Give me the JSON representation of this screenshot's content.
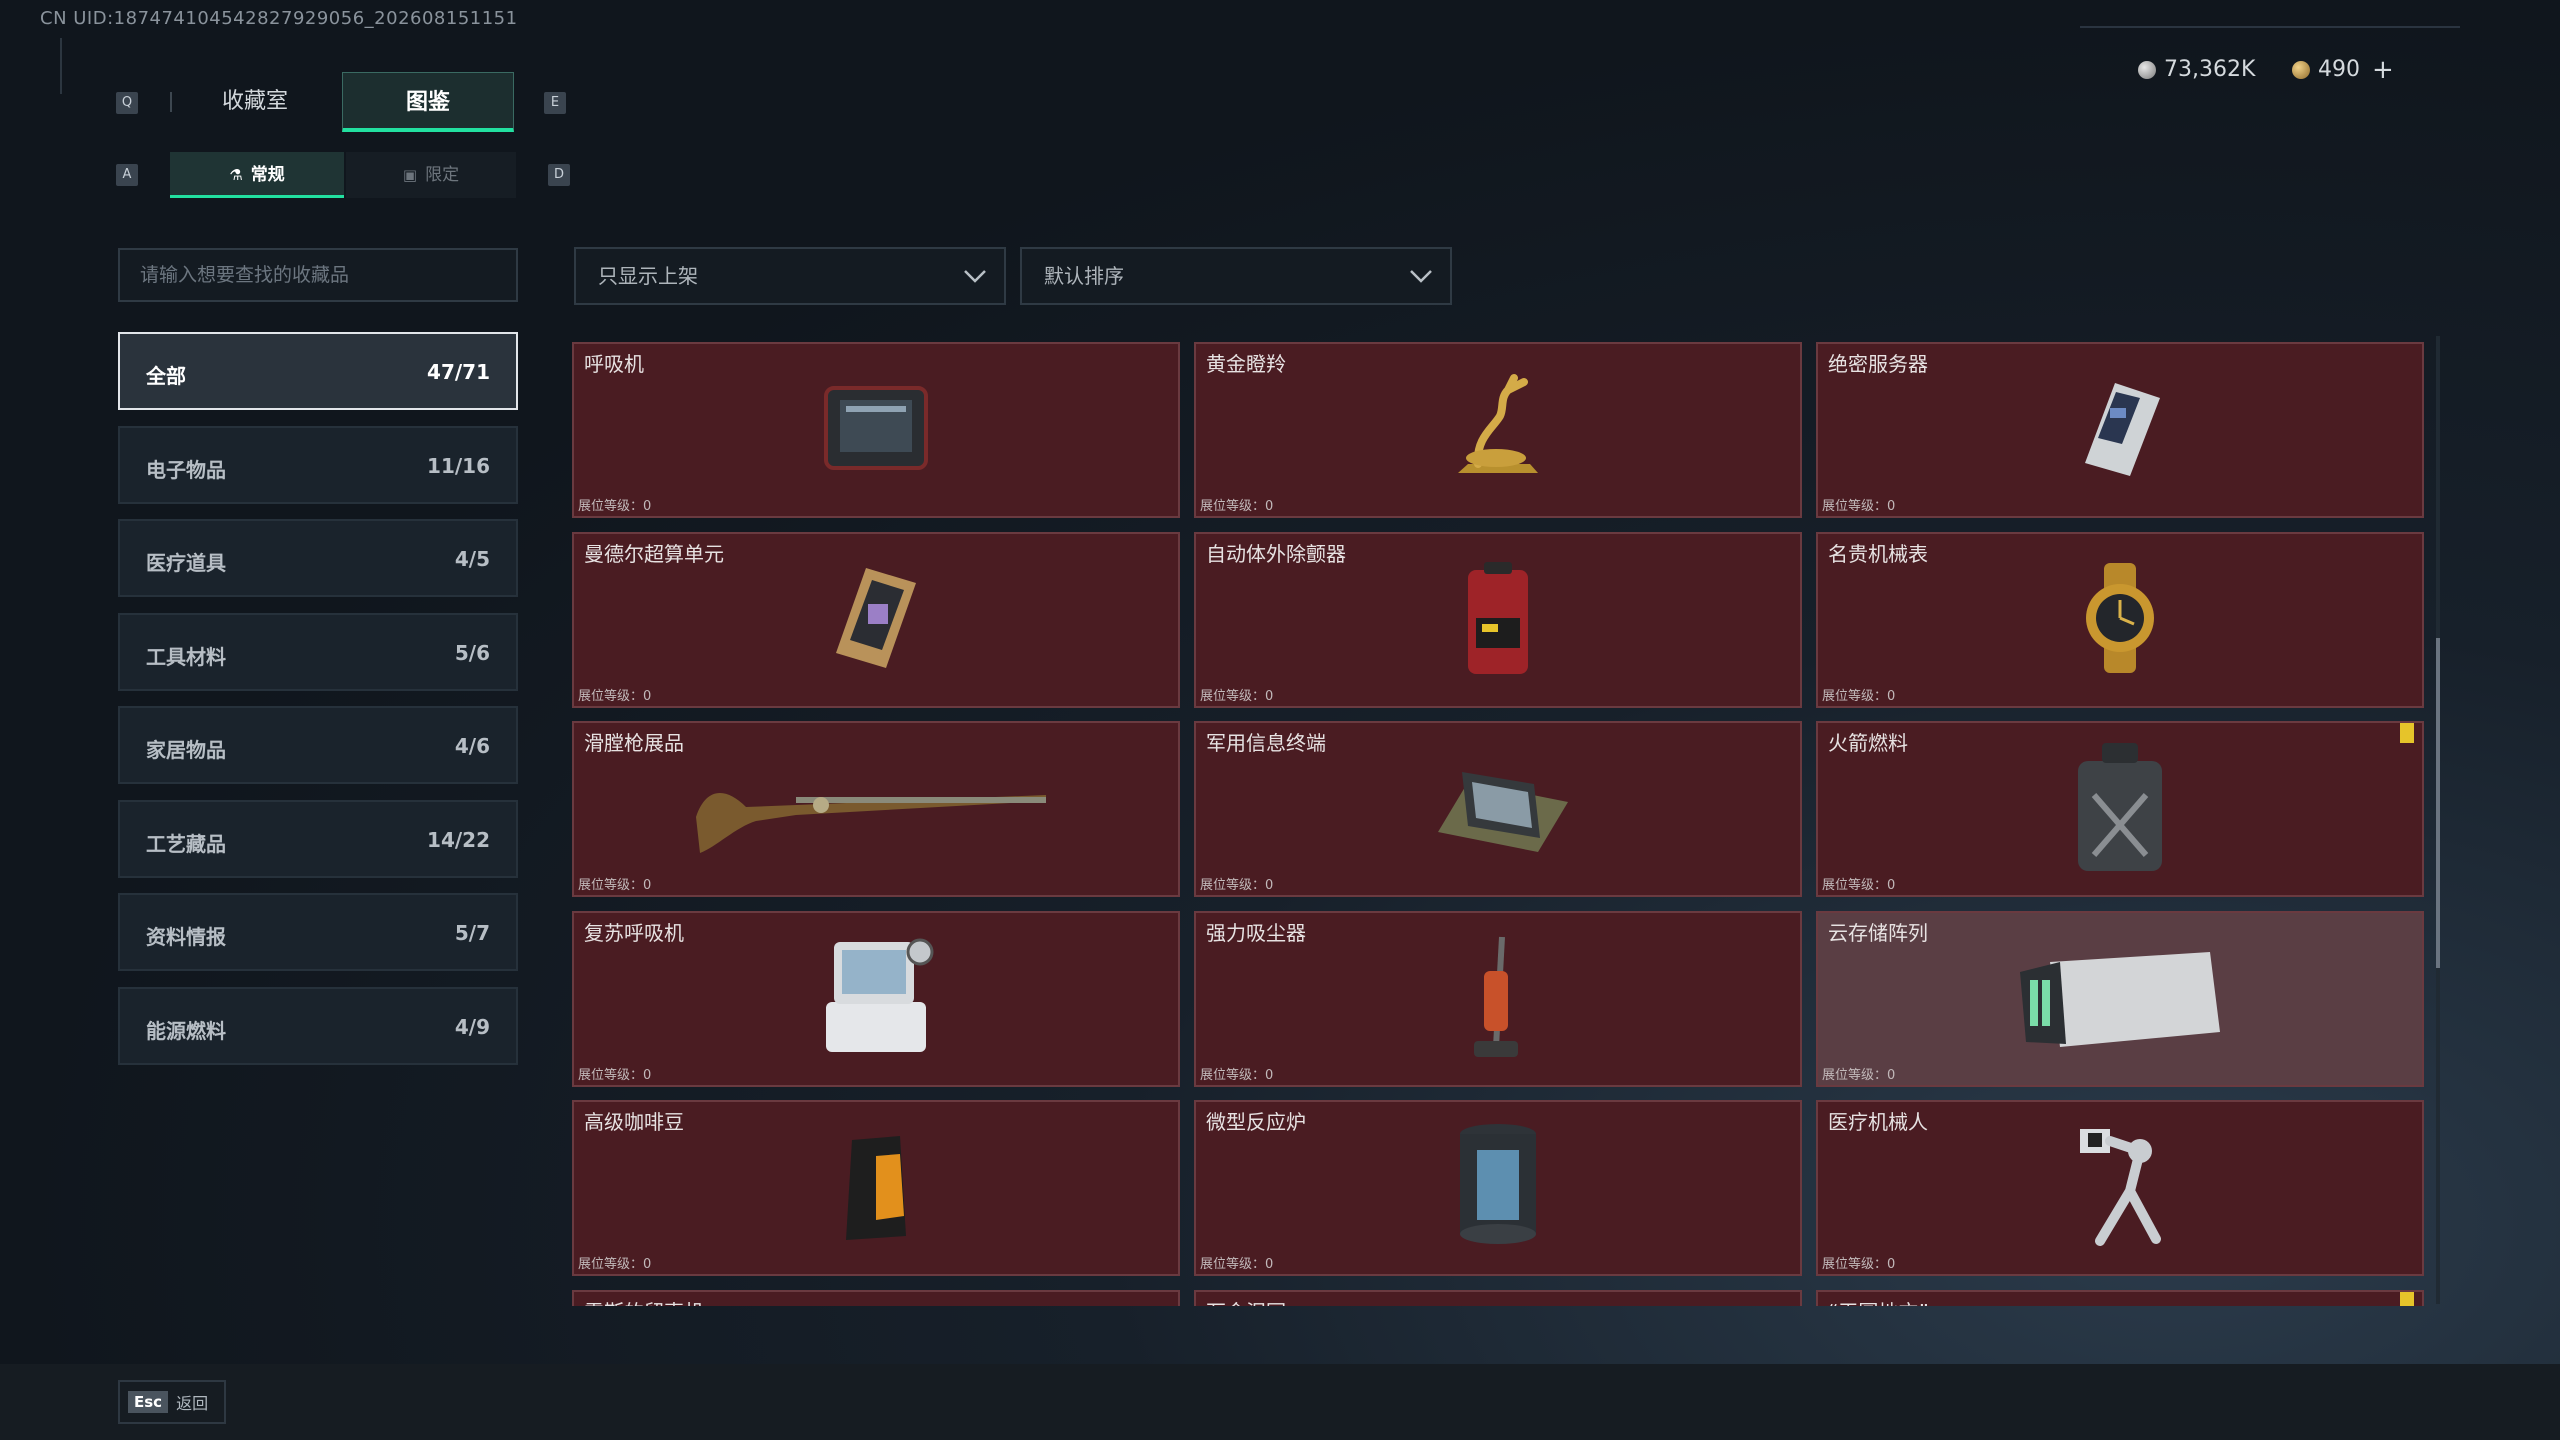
{
  "header": {
    "uid": "CN UID:187474104542827929056_202608151151"
  },
  "keys": {
    "q": "Q",
    "e": "E",
    "a": "A",
    "d": "D"
  },
  "tabs": {
    "collection": "收藏室",
    "codex": "图鉴"
  },
  "subtabs": {
    "regular": "常规",
    "limited": "限定"
  },
  "currency": {
    "silver": "73,362K",
    "gold": "490",
    "plus": "+"
  },
  "search": {
    "placeholder": "请输入想要查找的收藏品"
  },
  "filters": {
    "display": "只显示上架",
    "sort": "默认排序"
  },
  "categories": [
    {
      "name": "全部",
      "count": "47/71"
    },
    {
      "name": "电子物品",
      "count": "11/16"
    },
    {
      "name": "医疗道具",
      "count": "4/5"
    },
    {
      "name": "工具材料",
      "count": "5/6"
    },
    {
      "name": "家居物品",
      "count": "4/6"
    },
    {
      "name": "工艺藏品",
      "count": "14/22"
    },
    {
      "name": "资料情报",
      "count": "5/7"
    },
    {
      "name": "能源燃料",
      "count": "4/9"
    }
  ],
  "items": [
    {
      "name": "呼吸机",
      "level": "展位等级：0",
      "icon": "ventilator-icon"
    },
    {
      "name": "黄金瞪羚",
      "level": "展位等级：0",
      "icon": "golden-gazelle-icon"
    },
    {
      "name": "绝密服务器",
      "level": "展位等级：0",
      "icon": "server-icon"
    },
    {
      "name": "曼德尔超算单元",
      "level": "展位等级：0",
      "icon": "compute-unit-icon"
    },
    {
      "name": "自动体外除颤器",
      "level": "展位等级：0",
      "icon": "defibrillator-icon"
    },
    {
      "name": "名贵机械表",
      "level": "展位等级：0",
      "icon": "watch-icon"
    },
    {
      "name": "滑膛枪展品",
      "level": "展位等级：0",
      "icon": "musket-icon"
    },
    {
      "name": "军用信息终端",
      "level": "展位等级：0",
      "icon": "military-terminal-icon"
    },
    {
      "name": "火箭燃料",
      "level": "展位等级：0",
      "icon": "fuel-can-icon"
    },
    {
      "name": "复苏呼吸机",
      "level": "展位等级：0",
      "icon": "resuscitator-icon"
    },
    {
      "name": "强力吸尘器",
      "level": "展位等级：0",
      "icon": "vacuum-icon"
    },
    {
      "name": "云存储阵列",
      "level": "展位等级：0",
      "icon": "storage-array-icon"
    },
    {
      "name": "高级咖啡豆",
      "level": "展位等级：0",
      "icon": "coffee-bag-icon"
    },
    {
      "name": "微型反应炉",
      "level": "展位等级：0",
      "icon": "reactor-icon"
    },
    {
      "name": "医疗机械人",
      "level": "展位等级：0",
      "icon": "medical-robot-icon"
    },
    {
      "name": "雷斯的留声机",
      "level": "",
      "icon": ""
    },
    {
      "name": "万金泪冠",
      "level": "",
      "icon": ""
    },
    {
      "name": "“天圆地方”",
      "level": "",
      "icon": ""
    }
  ],
  "footer": {
    "esc": "Esc",
    "back": "返回"
  },
  "colors": {
    "accent": "#22e0a0",
    "card_bg": "#4a1c22",
    "flag": "#e6c42a"
  }
}
